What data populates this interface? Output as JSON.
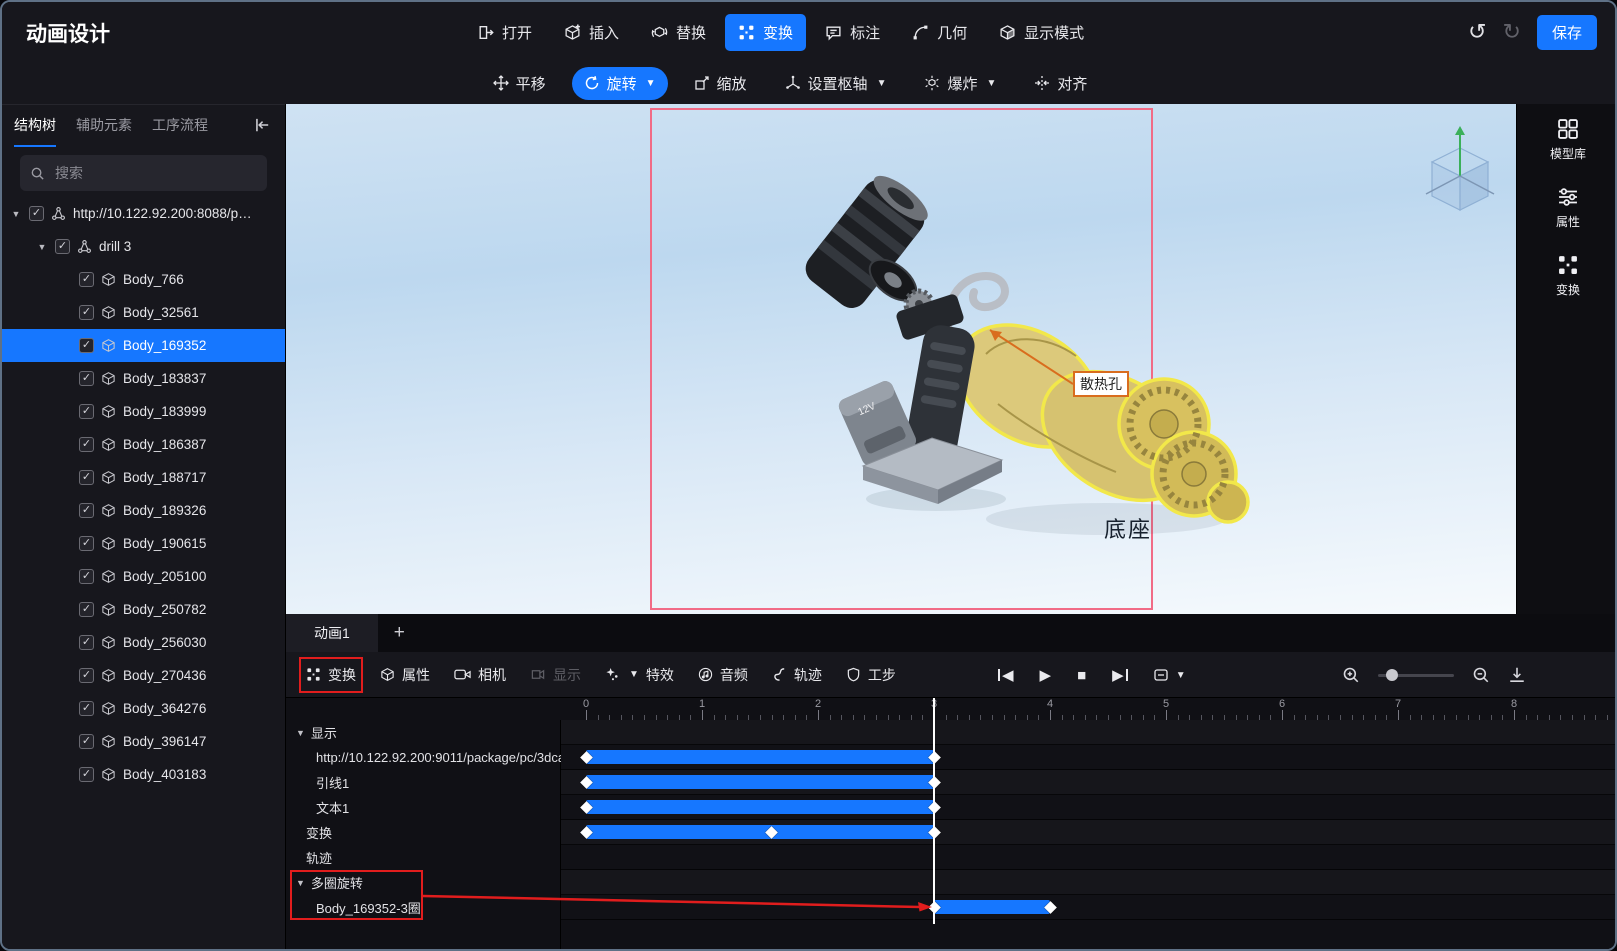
{
  "accent_color": "#1677ff",
  "app": {
    "title": "动画设计"
  },
  "top_bar": {
    "items": [
      {
        "label": "打开"
      },
      {
        "label": "插入"
      },
      {
        "label": "替换"
      },
      {
        "label": "变换",
        "active": true
      },
      {
        "label": "标注"
      },
      {
        "label": "几何"
      },
      {
        "label": "显示模式"
      }
    ],
    "save_label": "保存"
  },
  "transform_toolbar": {
    "items": [
      {
        "label": "平移"
      },
      {
        "label": "旋转",
        "active": true,
        "has_dropdown": true
      },
      {
        "label": "缩放"
      },
      {
        "label": "设置枢轴",
        "has_dropdown": true
      },
      {
        "label": "爆炸",
        "has_dropdown": true
      },
      {
        "label": "对齐"
      }
    ]
  },
  "sidebar": {
    "tabs": [
      {
        "label": "结构树",
        "active": true
      },
      {
        "label": "辅助元素"
      },
      {
        "label": "工序流程"
      }
    ],
    "search_placeholder": "搜索",
    "tree": {
      "root": "http://10.122.92.200:8088/pack...",
      "group": "drill 3",
      "selected": "Body_169352",
      "bodies": [
        "Body_766",
        "Body_32561",
        "Body_169352",
        "Body_183837",
        "Body_183999",
        "Body_186387",
        "Body_188717",
        "Body_189326",
        "Body_190615",
        "Body_205100",
        "Body_250782",
        "Body_256030",
        "Body_270436",
        "Body_364276",
        "Body_396147",
        "Body_403183"
      ]
    }
  },
  "viewport": {
    "annotation_label": "散热孔",
    "part_caption": "底座",
    "battery_label": "12V",
    "selection_highlight_color": "#f2e84a",
    "frame_color": "#f16b86"
  },
  "right_rail": {
    "items": [
      {
        "label": "模型库"
      },
      {
        "label": "属性"
      },
      {
        "label": "变换"
      }
    ]
  },
  "timeline": {
    "tab_label": "动画1",
    "add_tab_label": "+",
    "toolbar": [
      {
        "label": "变换",
        "highlighted": true
      },
      {
        "label": "属性"
      },
      {
        "label": "相机"
      },
      {
        "label": "显示",
        "disabled": true
      },
      {
        "label": "特效",
        "has_dropdown": true
      },
      {
        "label": "音频"
      },
      {
        "label": "轨迹"
      },
      {
        "label": "工步"
      }
    ],
    "ruler": {
      "majors": [
        0,
        1,
        2,
        3,
        4,
        5,
        6,
        7,
        8
      ],
      "end": 8.9
    },
    "playhead_time": 3,
    "annotation_color": "#e11d1d",
    "tracks": [
      {
        "type": "section",
        "label": "显示"
      },
      {
        "type": "clip",
        "child": true,
        "label": "http://10.122.92.200:9011/package/pc/3dca...",
        "start": 0,
        "end": 3,
        "keyframes": [
          0,
          3
        ]
      },
      {
        "type": "clip",
        "child": true,
        "label": "引线1",
        "start": 0,
        "end": 3,
        "keyframes": [
          0,
          3
        ]
      },
      {
        "type": "clip",
        "child": true,
        "label": "文本1",
        "start": 0,
        "end": 3,
        "keyframes": [
          0,
          3
        ]
      },
      {
        "type": "clip",
        "label": "变换",
        "start": 0,
        "end": 3,
        "keyframes": [
          0,
          1.6,
          3
        ]
      },
      {
        "type": "empty",
        "label": "轨迹"
      },
      {
        "type": "section",
        "label": "多圈旋转",
        "highlighted": true
      },
      {
        "type": "clip",
        "child": true,
        "label": "Body_169352-3圈",
        "start": 3,
        "end": 4,
        "keyframes": [
          3,
          4
        ]
      }
    ]
  }
}
